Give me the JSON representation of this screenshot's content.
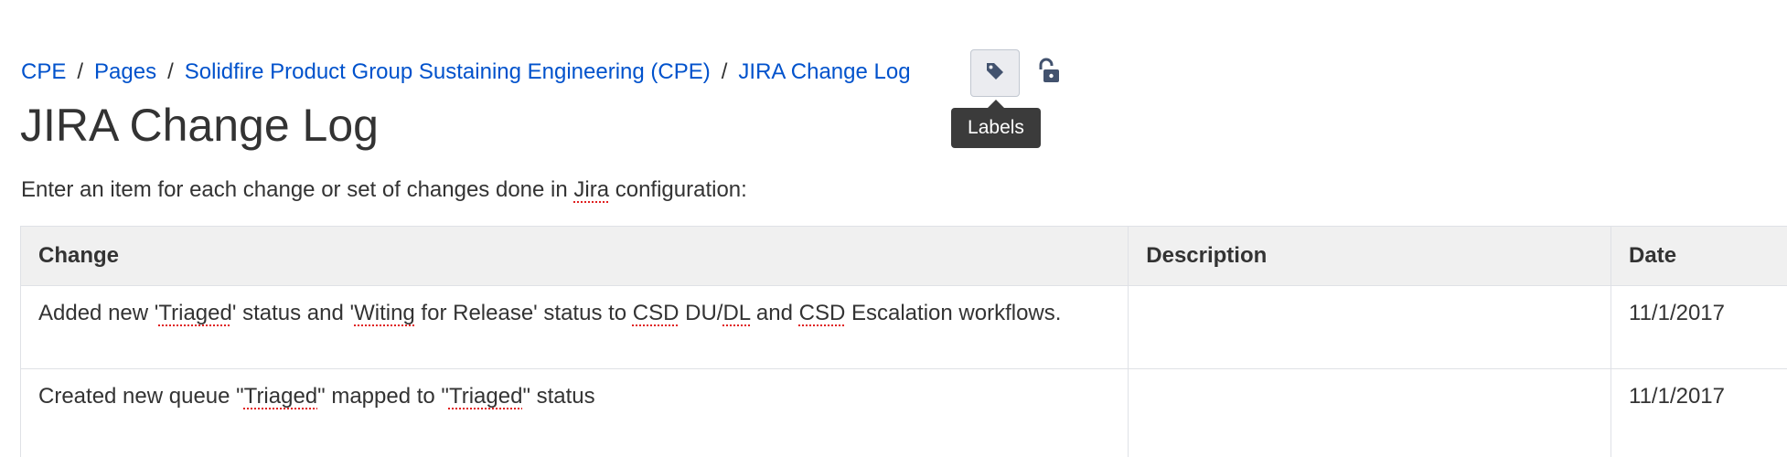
{
  "breadcrumb": {
    "items": [
      {
        "label": "CPE"
      },
      {
        "label": "Pages"
      },
      {
        "label": "Solidfire Product Group Sustaining Engineering (CPE)"
      },
      {
        "label": "JIRA Change Log"
      }
    ],
    "separator": "/"
  },
  "toolbar": {
    "labels_tooltip": "Labels",
    "labels_icon": "tag-icon",
    "restrictions_icon": "unlock-icon"
  },
  "page": {
    "title": "JIRA Change Log",
    "intro_before": "Enter an item for each change or set of changes done in ",
    "intro_jira": "Jira",
    "intro_after": " configuration:"
  },
  "table": {
    "headers": [
      "Change",
      "Description",
      "Date"
    ],
    "rows": [
      {
        "change_parts": [
          "Added new '",
          "Triaged",
          "' status and '",
          "Witing",
          " for Release' status to ",
          "CSD",
          " DU/",
          "DL",
          " and ",
          "CSD",
          " Escalation workflows."
        ],
        "description": "",
        "date": "11/1/2017"
      },
      {
        "change_parts": [
          "Created new queue \"",
          "Triaged",
          "\" mapped to \"",
          "Triaged",
          "\" status"
        ],
        "description": "",
        "date": "11/1/2017"
      }
    ]
  },
  "colors": {
    "link": "#0052cc",
    "text": "#333333",
    "header_bg": "#f0f0f0",
    "tooltip_bg": "#3b3b3b",
    "spellcheck": "#e02020"
  }
}
